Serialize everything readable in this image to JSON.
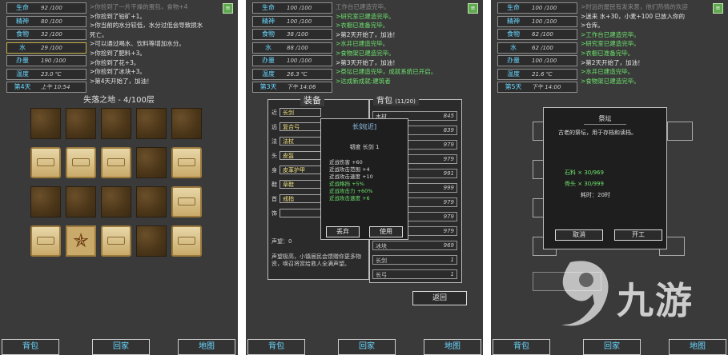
{
  "stats": [
    {
      "k": "生命",
      "v": "92 /100"
    },
    {
      "k": "精神",
      "v": "80 /100"
    },
    {
      "k": "食物",
      "v": "32 /100"
    },
    {
      "k": "水",
      "v": "29 /100"
    },
    {
      "k": "办量",
      "v": "190 /100"
    },
    {
      "k": "温度",
      "v": "23.0 ℃"
    },
    {
      "k": "第4天",
      "v": "上午 10:54"
    }
  ],
  "stats2": [
    {
      "k": "生命",
      "v": "100 /100"
    },
    {
      "k": "精神",
      "v": "100 /100"
    },
    {
      "k": "食物",
      "v": "38 /100"
    },
    {
      "k": "水",
      "v": "88 /100"
    },
    {
      "k": "办量",
      "v": "100 /100"
    },
    {
      "k": "温度",
      "v": "26.3 ℃"
    },
    {
      "k": "第3天",
      "v": "下午 14:06"
    }
  ],
  "stats3": [
    {
      "k": "生命",
      "v": "100 /100"
    },
    {
      "k": "精神",
      "v": "100 /100"
    },
    {
      "k": "食物",
      "v": "62 /100"
    },
    {
      "k": "水",
      "v": "62 /100"
    },
    {
      "k": "办量",
      "v": "100 /100"
    },
    {
      "k": "温度",
      "v": "21.6 ℃"
    },
    {
      "k": "第5天",
      "v": "下午 14:00"
    }
  ],
  "log1": [
    ">你捡到了一片干燥的蛋包，食物+4",
    ">你捡到了铂矿+1。",
    ">你当前的水分较低，水分过低会导致损水",
    "死亡。",
    ">可以通过喝水、饮料等增加水分。",
    ">你捡到了肥料+3。",
    ">你捡到了花+3。",
    ">你捡到了冰块+3。",
    ">第4天开始了，加油！"
  ],
  "log2": [
    "工作台已建造完毕。",
    ">研究室已建造完毕。",
    ">衣橱已准备完毕。",
    ">第2天开始了，加油！",
    ">水井已建造完毕。",
    ">食物架已建造完毕。",
    ">第3天开始了，加油！",
    ">祭坛已建造完毕，成就系统已开启。",
    ">达成新成就:建筑者"
  ],
  "log3": [
    ">时远的屋民有发来意，他们热情的欢迎",
    ">迷来 水+30，小麦+100 已放入你的",
    ">仓库。",
    ">工作台已建造完毕。",
    ">研究室已建造完毕。",
    ">衣橱已准备完毕。",
    ">第2天开始了，加油！",
    ">水井已建造完毕。",
    ">食物架已建造完毕。"
  ],
  "corner_label": "≡",
  "map_title": "失落之地 - 4/100层",
  "bottom_buttons": [
    "背包",
    "回家",
    "地图"
  ],
  "equip": {
    "header": "装备",
    "slots": [
      {
        "k": "近",
        "v": "长剑"
      },
      {
        "k": "远",
        "v": "复合弓"
      },
      {
        "k": "法",
        "v": "法杖"
      },
      {
        "k": "头",
        "v": "皮盔"
      },
      {
        "k": "身",
        "v": "皮革护甲"
      },
      {
        "k": "鞋",
        "v": "草鞋"
      },
      {
        "k": "首",
        "v": "戒指"
      },
      {
        "k": "饰",
        "v": ""
      }
    ],
    "fame_label": "声望：0",
    "desc": "声望极高，小镇居民会馈赠你更多物资，唤召将赏给救人全满声望。"
  },
  "bag": {
    "header": "背包",
    "count": "(11/20)",
    "items": [
      {
        "n": "木材",
        "c": "845"
      },
      {
        "n": "石料",
        "c": "839"
      },
      {
        "n": "水",
        "c": "979"
      },
      {
        "n": "小麦",
        "c": "979"
      },
      {
        "n": "布料",
        "c": "991"
      },
      {
        "n": "肥料",
        "c": "999"
      },
      {
        "n": "皮革",
        "c": "979"
      },
      {
        "n": "树枝",
        "c": "979"
      },
      {
        "n": "花",
        "c": "979"
      },
      {
        "n": "冰块",
        "c": "969"
      },
      {
        "n": "长剑",
        "c": "1"
      },
      {
        "n": "长弓",
        "c": "1"
      }
    ],
    "back_btn": "返回"
  },
  "item_popup": {
    "title": "长剑[近]",
    "sub": "韧度 长剑 1",
    "lines": [
      "近战伤害 +60",
      "近战攻击范围 +4",
      "近战攻击速度 +10",
      "近战格挡 +5%",
      "近战攻击力 +60%",
      "近战攻击速度 +6"
    ],
    "btn1": "丢弃",
    "btn2": "使用"
  },
  "altar_popup": {
    "title": "祭坛",
    "desc": "古老的祭坛，用于存档和读档。",
    "req1": "石料 × 30/969",
    "req2": "骨头 × 30/999",
    "time": "耗时：20时",
    "btn_cancel": "取消",
    "btn_build": "开工"
  },
  "watermark_text": "九游"
}
